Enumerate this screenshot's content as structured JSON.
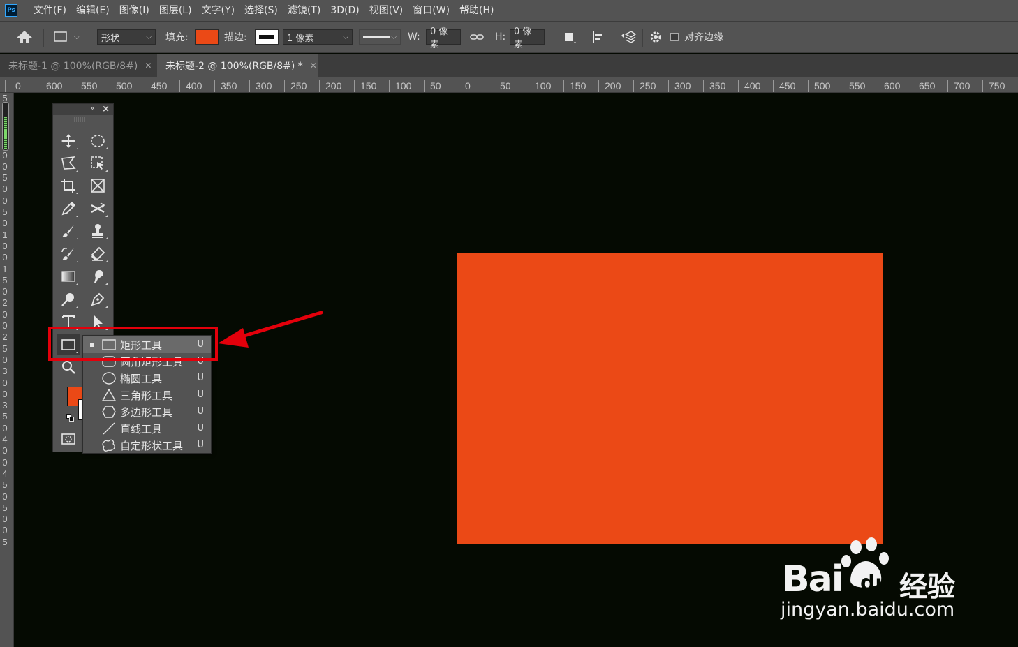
{
  "app": {
    "logo_text": "Ps"
  },
  "menu": [
    "文件(F)",
    "编辑(E)",
    "图像(I)",
    "图层(L)",
    "文字(Y)",
    "选择(S)",
    "滤镜(T)",
    "3D(D)",
    "视图(V)",
    "窗口(W)",
    "帮助(H)"
  ],
  "options": {
    "mode_value": "形状",
    "fill_label": "填充:",
    "fill_color": "#eb4916",
    "stroke_label": "描边:",
    "stroke_width": "1 像素",
    "w_label": "W:",
    "w_value": "0 像素",
    "h_label": "H:",
    "h_value": "0 像素",
    "align_edges_label": "对齐边缘"
  },
  "tabs": [
    {
      "title": "未标题-1 @ 100%(RGB/8#)",
      "active": false
    },
    {
      "title": "未标题-2 @ 100%(RGB/8#) *",
      "active": true
    }
  ],
  "ruler_top_labels": [
    "0",
    "600",
    "550",
    "500",
    "450",
    "400",
    "350",
    "300",
    "250",
    "200",
    "150",
    "100",
    "50",
    "0",
    "50",
    "100",
    "150",
    "200",
    "250",
    "300",
    "350",
    "400",
    "450",
    "500",
    "550",
    "600",
    "650",
    "700",
    "750"
  ],
  "ruler_left_labels": [
    "5",
    "0",
    "5",
    "0",
    "1",
    "0",
    "0",
    "5",
    "0",
    "0",
    "5",
    "0",
    "1",
    "0",
    "0",
    "1",
    "5",
    "0",
    "2",
    "0",
    "0",
    "2",
    "5",
    "0",
    "3",
    "0",
    "0",
    "3",
    "5",
    "0",
    "4",
    "0",
    "0",
    "4",
    "5",
    "0",
    "5",
    "0",
    "0",
    "5"
  ],
  "flyout": [
    {
      "label": "矩形工具",
      "key": "U",
      "icon": "rectangle-icon",
      "selected": true
    },
    {
      "label": "圆角矩形工具",
      "key": "U",
      "icon": "rounded-rectangle-icon",
      "selected": false
    },
    {
      "label": "椭圆工具",
      "key": "U",
      "icon": "ellipse-icon",
      "selected": false
    },
    {
      "label": "三角形工具",
      "key": "U",
      "icon": "triangle-icon",
      "selected": false
    },
    {
      "label": "多边形工具",
      "key": "U",
      "icon": "polygon-icon",
      "selected": false
    },
    {
      "label": "直线工具",
      "key": "U",
      "icon": "line-icon",
      "selected": false
    },
    {
      "label": "自定形状工具",
      "key": "U",
      "icon": "custom-shape-icon",
      "selected": false
    }
  ],
  "colors": {
    "foreground": "#eb4916",
    "background": "#ffffff",
    "highlight": "#e3000b",
    "canvas_bg": "#050a02"
  },
  "watermark": {
    "brand": "Bai",
    "logo_text": "du",
    "suffix": "经验",
    "url": "jingyan.baidu.com"
  }
}
